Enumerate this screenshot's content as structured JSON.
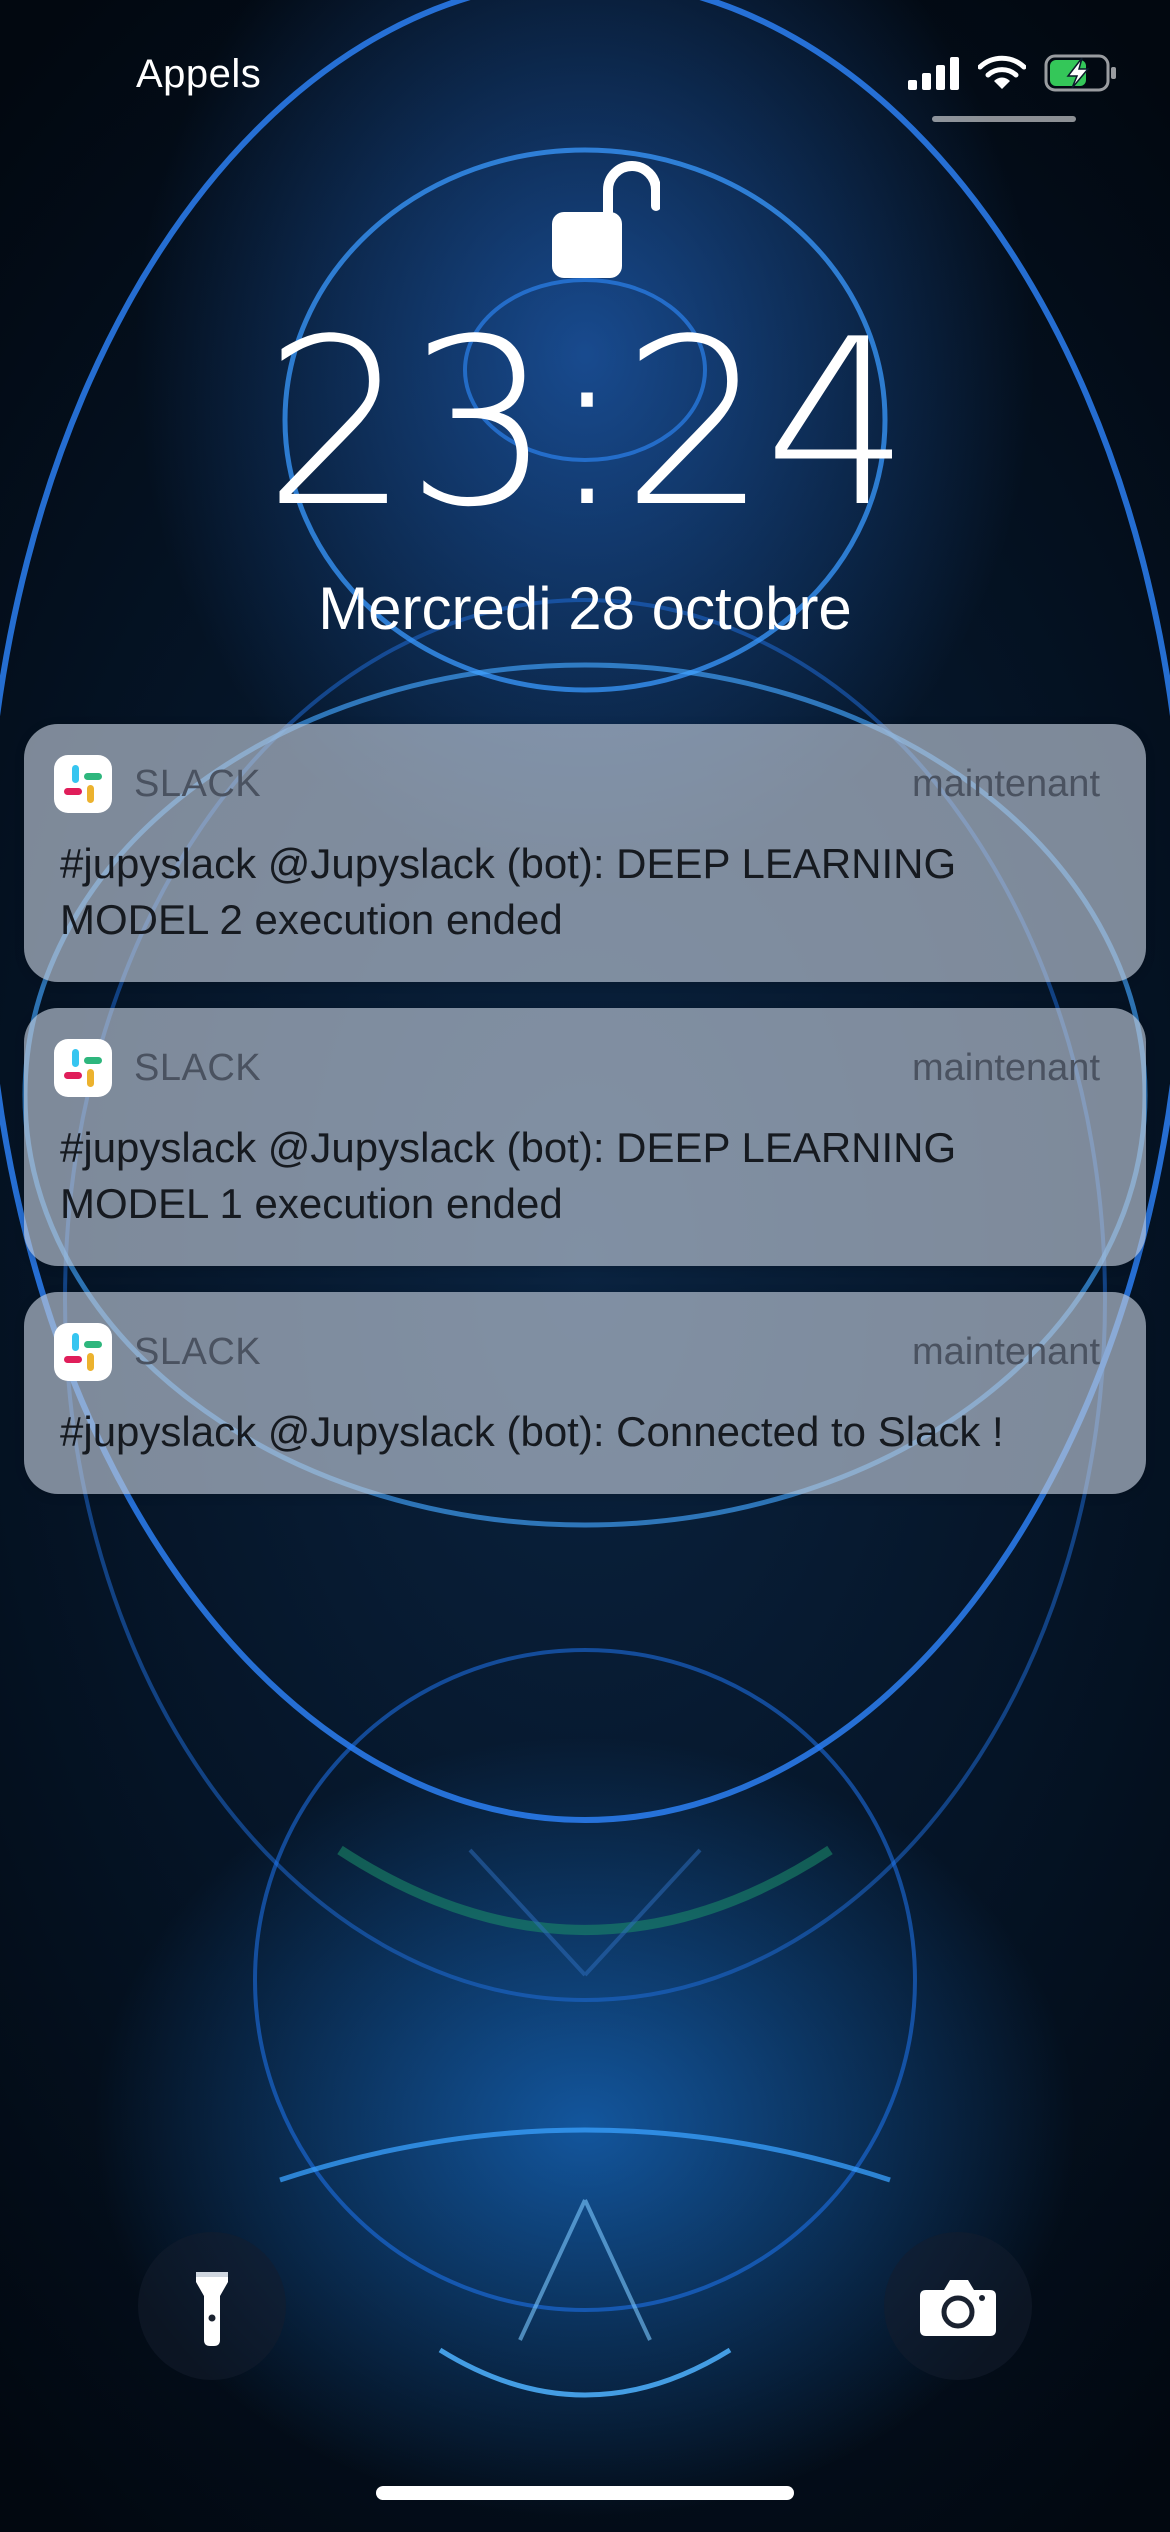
{
  "status_bar": {
    "carrier": "Appels",
    "battery_charging": true
  },
  "lock_screen": {
    "time": "23:24",
    "date": "Mercredi 28 octobre",
    "locked": false
  },
  "notifications": [
    {
      "app": "SLACK",
      "time": "maintenant",
      "message": "#jupyslack @Jupyslack (bot): DEEP LEARNING MODEL 2 execution ended"
    },
    {
      "app": "SLACK",
      "time": "maintenant",
      "message": "#jupyslack @Jupyslack (bot): DEEP LEARNING MODEL 1 execution ended"
    },
    {
      "app": "SLACK",
      "time": "maintenant",
      "message": "#jupyslack @Jupyslack (bot): Connected to Slack !"
    }
  ],
  "quick_actions": {
    "left": "flashlight-icon",
    "right": "camera-icon"
  },
  "colors": {
    "notification_bg": "#bec8d7",
    "battery_green": "#34c759",
    "text_dark": "#161a20",
    "text_meta": "#4a5260"
  }
}
